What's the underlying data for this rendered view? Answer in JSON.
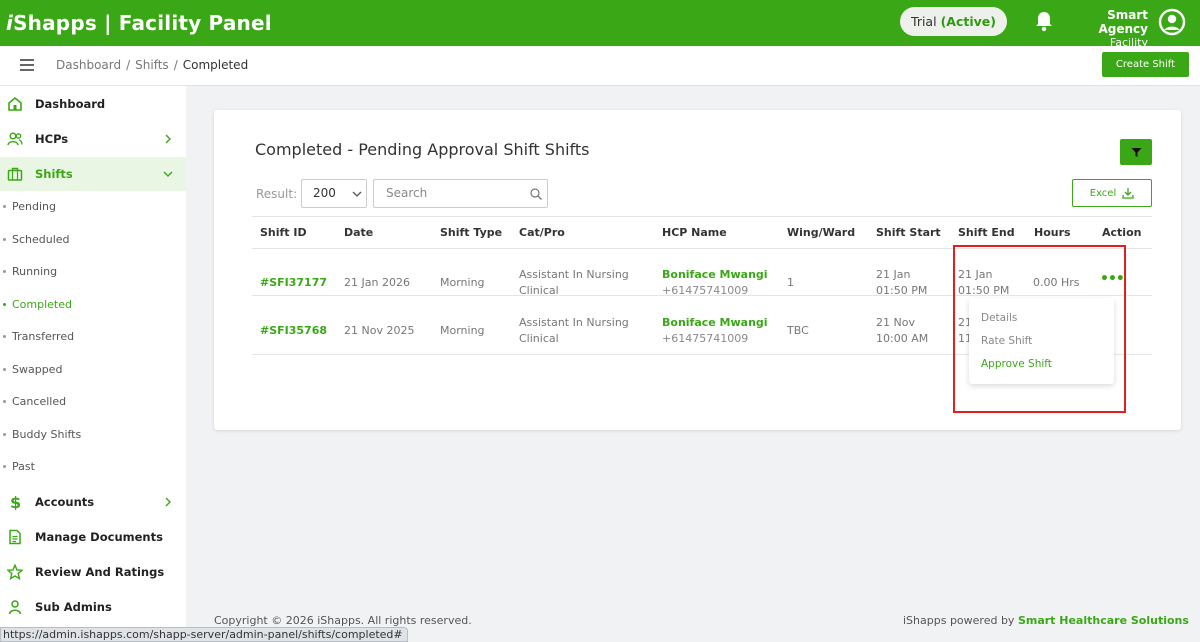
{
  "header": {
    "brand_prefix": "i",
    "brand_rest": "Shapps | Facility Panel",
    "trial_label": "Trial",
    "trial_status": "(Active)",
    "agency_name": "Smart Agency",
    "agency_role": "Facility"
  },
  "breadcrumb": {
    "items": [
      "Dashboard",
      "Shifts",
      "Completed"
    ],
    "separator": "/",
    "create_label": "Create Shift"
  },
  "sidebar": {
    "items": [
      {
        "label": "Dashboard",
        "icon": "home-icon"
      },
      {
        "label": "HCPs",
        "icon": "users-icon"
      },
      {
        "label": "Shifts",
        "icon": "briefcase-icon"
      },
      {
        "label": "Accounts",
        "icon": "dollar-icon"
      },
      {
        "label": "Manage Documents",
        "icon": "document-icon"
      },
      {
        "label": "Review And Ratings",
        "icon": "star-icon"
      },
      {
        "label": "Sub Admins",
        "icon": "user-icon"
      }
    ],
    "shift_sub": [
      "Pending",
      "Scheduled",
      "Running",
      "Completed",
      "Transferred",
      "Swapped",
      "Cancelled",
      "Buddy Shifts",
      "Past"
    ],
    "active_sub": "Completed"
  },
  "main": {
    "title": "Completed - Pending Approval Shift Shifts",
    "excel_label": "Excel",
    "result_label": "Result:",
    "result_value": "200",
    "search_placeholder": "Search",
    "columns": [
      "Shift ID",
      "Date",
      "Shift Type",
      "Cat/Pro",
      "HCP Name",
      "Wing/Ward",
      "Shift Start",
      "Shift End",
      "Hours",
      "Action"
    ],
    "rows": [
      {
        "id": "#SFI37177",
        "date": "21 Jan 2026",
        "type": "Morning",
        "cat1": "Assistant In Nursing",
        "cat2": "Clinical",
        "hcp": "Boniface Mwangi",
        "phone": "+61475741009",
        "ward": "1",
        "start_date": "21 Jan",
        "start_time": "01:50 PM",
        "end_date": "21 Jan",
        "end_time": "01:50 PM",
        "hours": "0.00 Hrs",
        "action": "•••"
      },
      {
        "id": "#SFI35768",
        "date": "21 Nov 2025",
        "type": "Morning",
        "cat1": "Assistant In Nursing",
        "cat2": "Clinical",
        "hcp": "Boniface Mwangi",
        "phone": "+61475741009",
        "ward": "TBC",
        "start_date": "21 Nov",
        "start_time": "10:00 AM",
        "end_date": "21",
        "end_time": "11",
        "hours": "",
        "action": ""
      }
    ],
    "action_menu": [
      "Details",
      "Rate Shift",
      "Approve Shift"
    ]
  },
  "footer": {
    "copyright": "Copyright © 2026 iShapps. All rights reserved.",
    "powered_prefix": "iShapps powered by ",
    "powered_link": "Smart Healthcare Solutions"
  },
  "status_url": "https://admin.ishapps.com/shapp-server/admin-panel/shifts/completed#",
  "colors": {
    "brand_green": "#3aa816",
    "highlight_red": "#e01f1f"
  }
}
